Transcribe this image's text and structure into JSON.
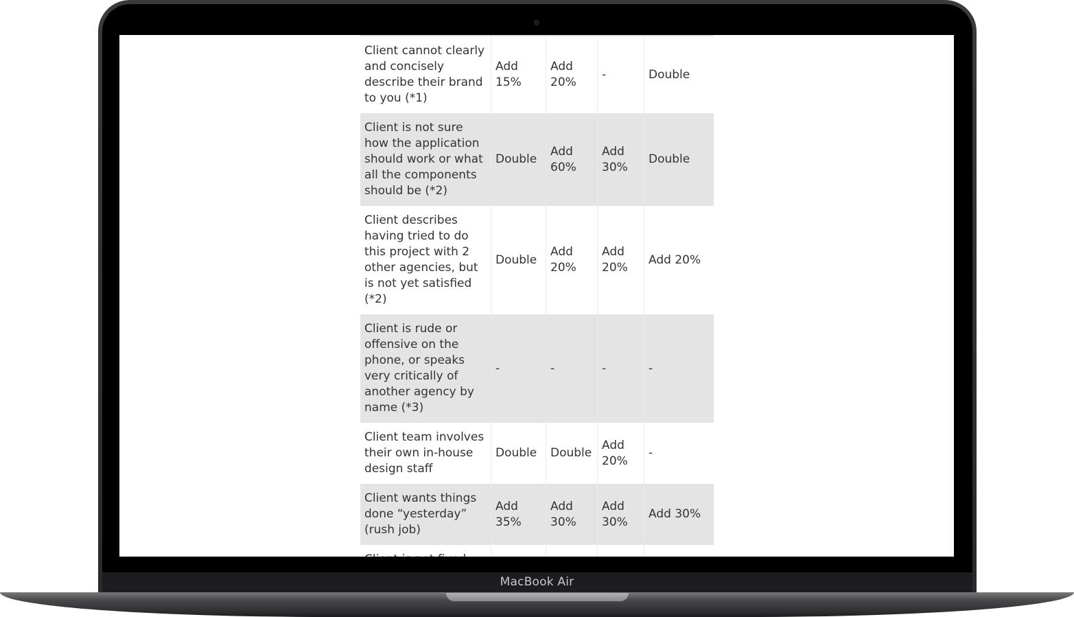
{
  "device": {
    "label": "MacBook Air"
  },
  "table": {
    "rows": [
      {
        "shaded": true,
        "cells": [
          "",
          "",
          "",
          "",
          ""
        ]
      },
      {
        "shaded": false,
        "cells": [
          "Client cannot clearly and concisely describe their brand to you (*1)",
          "Add 15%",
          "Add 20%",
          "-",
          "Double"
        ]
      },
      {
        "shaded": true,
        "cells": [
          "Client is not sure how the application should work or what all the components should be (*2)",
          "Double",
          "Add 60%",
          "Add 30%",
          "Double"
        ]
      },
      {
        "shaded": false,
        "cells": [
          "Client describes having tried to do this project with 2 other agencies, but is not yet satisfied (*2)",
          "Double",
          "Add 20%",
          "Add 20%",
          "Add 20%"
        ]
      },
      {
        "shaded": true,
        "cells": [
          "Client is rude or offensive on the phone, or speaks very critically of another agency by name (*3)",
          "-",
          "-",
          "-",
          "-"
        ]
      },
      {
        "shaded": false,
        "cells": [
          "Client team involves their own in-house design staff",
          "Double",
          "Double",
          "Add 20%",
          "-"
        ]
      },
      {
        "shaded": true,
        "cells": [
          "Client wants things done “yesterday” (rush job)",
          "Add 35%",
          "Add 30%",
          "Add 30%",
          "Add 30%"
        ]
      },
      {
        "shaded": false,
        "cells": [
          "Client is not fixed",
          "",
          "",
          "",
          ""
        ]
      }
    ]
  }
}
